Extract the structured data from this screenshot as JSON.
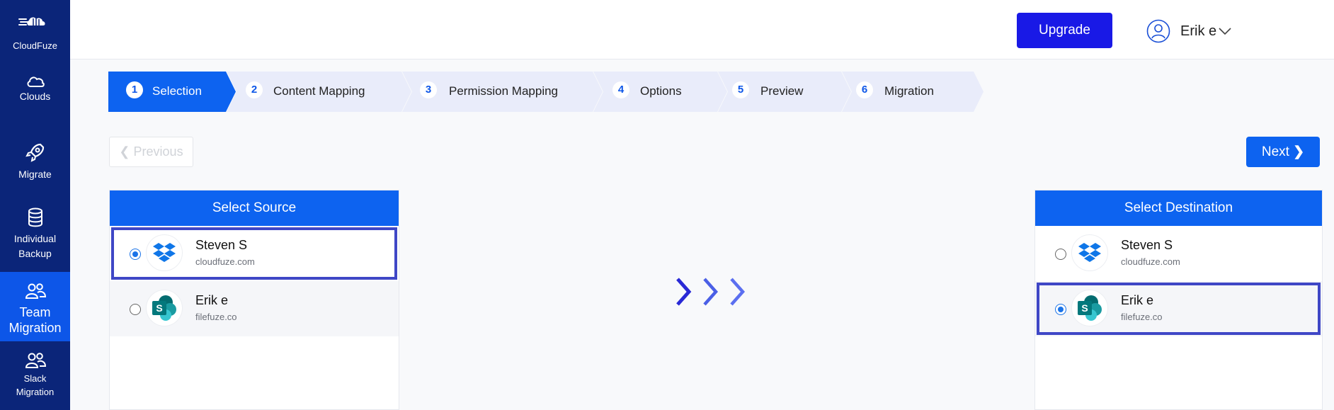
{
  "sidebar": {
    "brand": "CloudFuze",
    "items": [
      {
        "label": "Clouds"
      },
      {
        "label": "Migrate"
      },
      {
        "label_line1": "Individual",
        "label_line2": "Backup"
      },
      {
        "label_line1": "Team",
        "label_line2": "Migration",
        "active": true
      },
      {
        "label_line1": "Slack",
        "label_line2": "Migration"
      }
    ]
  },
  "header": {
    "upgrade_label": "Upgrade",
    "user_name": "Erik e"
  },
  "steps": [
    {
      "num": "1",
      "label": "Selection",
      "active": true
    },
    {
      "num": "2",
      "label": "Content Mapping"
    },
    {
      "num": "3",
      "label": "Permission Mapping"
    },
    {
      "num": "4",
      "label": "Options"
    },
    {
      "num": "5",
      "label": "Preview"
    },
    {
      "num": "6",
      "label": "Migration"
    }
  ],
  "nav": {
    "previous_label": "Previous",
    "next_label": "Next"
  },
  "source": {
    "title": "Select Source",
    "accounts": [
      {
        "name": "Steven S",
        "domain": "cloudfuze.com",
        "cloud": "dropbox",
        "selected": true
      },
      {
        "name": "Erik e",
        "domain": "filefuze.co",
        "cloud": "sharepoint",
        "selected": false
      }
    ]
  },
  "destination": {
    "title": "Select Destination",
    "accounts": [
      {
        "name": "Steven S",
        "domain": "cloudfuze.com",
        "cloud": "dropbox",
        "selected": false
      },
      {
        "name": "Erik e",
        "domain": "filefuze.co",
        "cloud": "sharepoint",
        "selected": true
      }
    ]
  },
  "colors": {
    "sidebar": "#0b2579",
    "sidebar_active": "#0d56e8",
    "primary": "#0d63f0",
    "upgrade": "#1919e6",
    "step_inactive": "#e9ecfa",
    "selection_outline": "#3f47c6"
  }
}
